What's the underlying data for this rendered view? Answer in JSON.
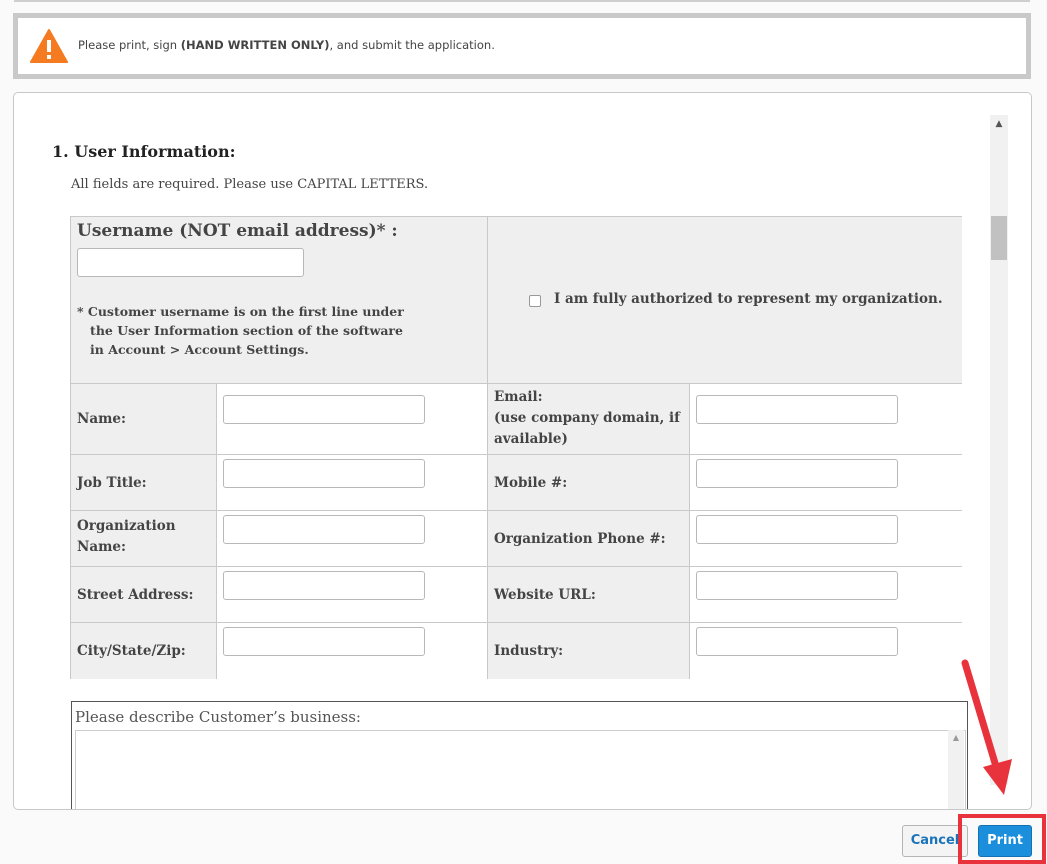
{
  "alert": {
    "icon": "warning-icon",
    "icon_color": "#f47b20",
    "text_prefix": "Please print, sign ",
    "text_bold": "(HAND WRITTEN ONLY)",
    "text_suffix": ", and submit the application."
  },
  "form": {
    "section_title": "1. User Information:",
    "section_note": "All fields are required. Please use CAPITAL LETTERS.",
    "username_label": "Username (NOT email address)* :",
    "username_value": "",
    "username_note": "* Customer username is on the first line under\n   the User Information section of the software\n   in Account > Account Settings.",
    "authorized_label": "I am fully authorized to represent my organization.",
    "authorized_checked": false,
    "fields": [
      {
        "left_label": "Name:",
        "left_value": "",
        "right_label": "Email:\n(use company domain, if\navailable)",
        "right_value": ""
      },
      {
        "left_label": "Job Title:",
        "left_value": "",
        "right_label": "Mobile #:",
        "right_value": ""
      },
      {
        "left_label": "Organization\nName:",
        "left_value": "",
        "right_label": "Organization Phone #:",
        "right_value": ""
      },
      {
        "left_label": "Street Address:",
        "left_value": "",
        "right_label": "Website URL:",
        "right_value": ""
      },
      {
        "left_label": "City/State/Zip:",
        "left_value": "",
        "right_label": "Industry:",
        "right_value": ""
      }
    ],
    "describe_label": "Please describe Customer’s business:",
    "describe_value": ""
  },
  "footer": {
    "cancel_label": "Cancel",
    "print_label": "Print"
  },
  "colors": {
    "accent": "#1b8fdc",
    "highlight": "#e8333d"
  }
}
